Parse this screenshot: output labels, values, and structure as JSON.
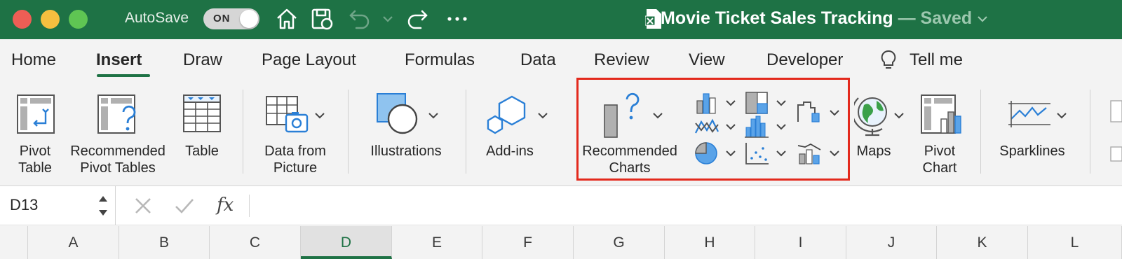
{
  "titlebar": {
    "autosave_label": "AutoSave",
    "autosave_state": "ON",
    "doc_name": "Movie Ticket Sales Tracking",
    "saved_status": "— Saved",
    "accent_color": "#1e7245"
  },
  "tabs": [
    {
      "label": "Home"
    },
    {
      "label": "Insert",
      "active": true
    },
    {
      "label": "Draw"
    },
    {
      "label": "Page Layout"
    },
    {
      "label": "Formulas"
    },
    {
      "label": "Data"
    },
    {
      "label": "Review"
    },
    {
      "label": "View"
    },
    {
      "label": "Developer"
    },
    {
      "label": "Tell me"
    }
  ],
  "ribbon": {
    "pivot_table": "Pivot\nTable",
    "pivot_table_l1": "Pivot",
    "pivot_table_l2": "Table",
    "recommended_pivot_l1": "Recommended",
    "recommended_pivot_l2": "Pivot Tables",
    "table": "Table",
    "data_from_picture_l1": "Data from",
    "data_from_picture_l2": "Picture",
    "illustrations": "Illustrations",
    "addins": "Add-ins",
    "recommended_charts_l1": "Recommended",
    "recommended_charts_l2": "Charts",
    "maps": "Maps",
    "pivot_chart_l1": "Pivot",
    "pivot_chart_l2": "Chart",
    "sparklines": "Sparklines",
    "highlight_color": "#e3291c"
  },
  "formula_bar": {
    "name_box": "D13",
    "fx_label": "fx"
  },
  "columns": [
    "A",
    "B",
    "C",
    "D",
    "E",
    "F",
    "G",
    "H",
    "I",
    "J",
    "K",
    "L"
  ],
  "active_column": "D"
}
